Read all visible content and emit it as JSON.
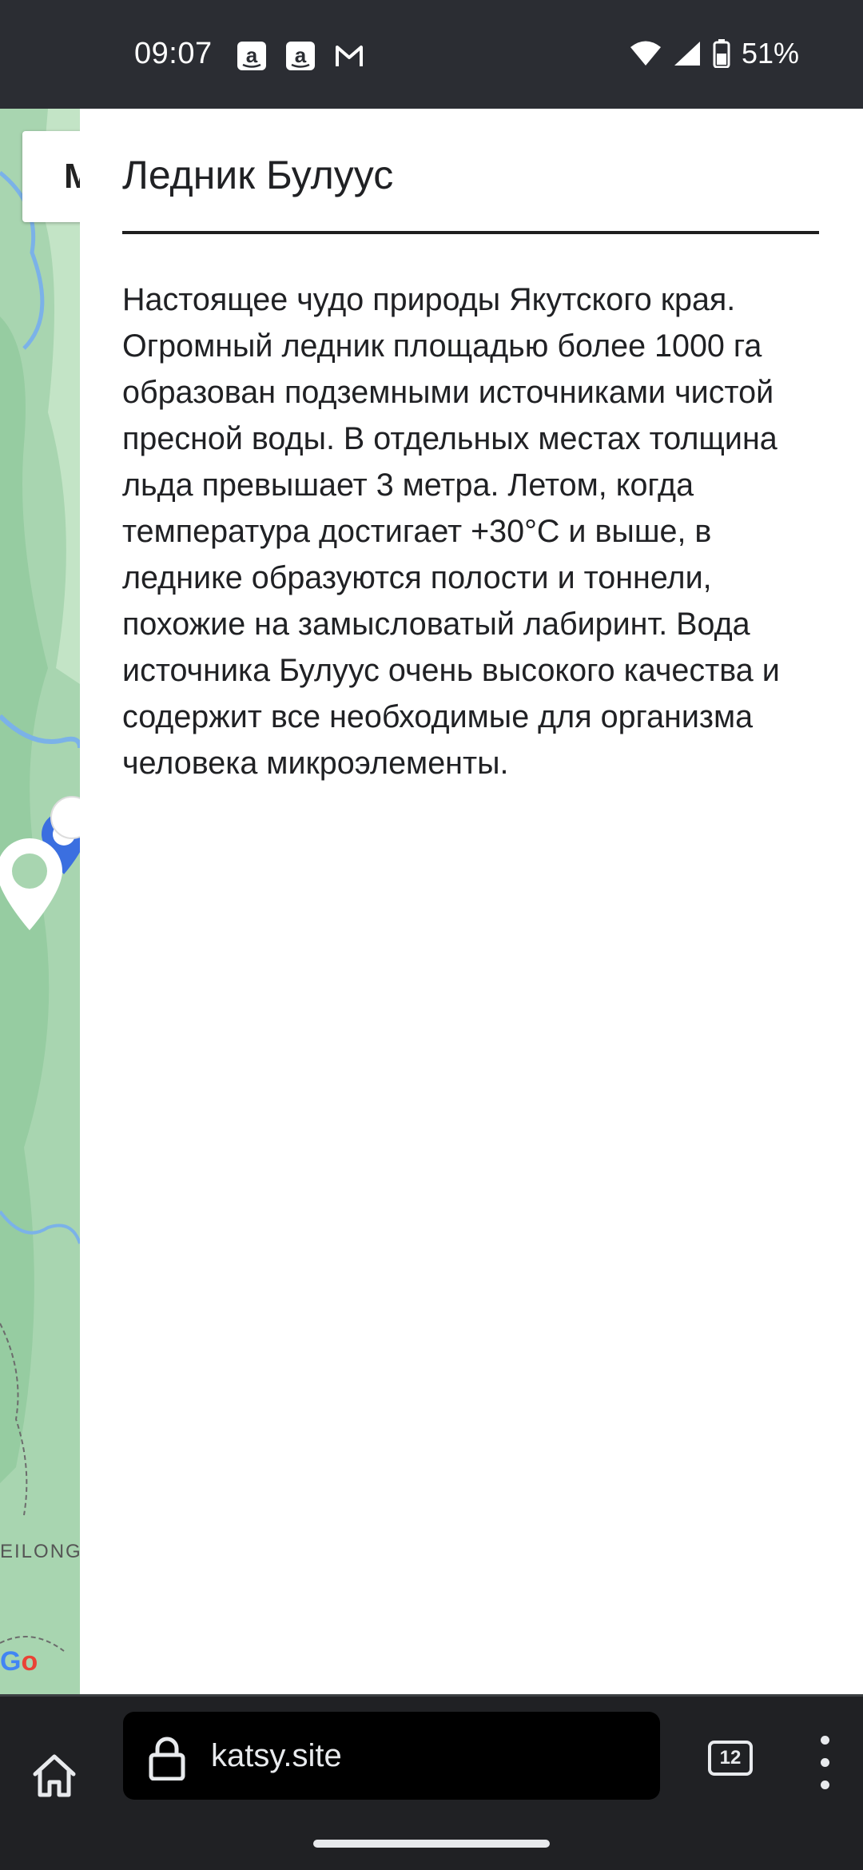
{
  "status_bar": {
    "time": "09:07",
    "battery": "51%",
    "icons": [
      "amazon-notification-icon",
      "amazon-notification-icon",
      "gmail-notification-icon",
      "wifi-icon",
      "cellular-signal-icon",
      "battery-icon"
    ]
  },
  "map": {
    "map_type_button_label": "M",
    "region_label": "EILONG",
    "google_logo_part1": "G",
    "google_logo_part2": "o"
  },
  "info_panel": {
    "title": "Ледник Булуус",
    "description": "Настоящее чудо природы Якутского края. Огромный ледник площадью более 1000 га образован подземными источниками чистой пресной воды. В отдельных местах толщина льда превышает 3 метра. Летом, когда температура достигает +30°С и выше, в леднике образуются полости и тоннели, похожие на замысловатый лабиринт. Вода источника Булуус очень высокого качества и содержит все необходимые для организма человека микроэлементы."
  },
  "browser": {
    "url": "katsy.site",
    "tab_count": "12"
  },
  "colors": {
    "status_bar_bg": "#2b2d33",
    "browser_bar_bg": "#202124",
    "panel_bg": "#ffffff",
    "map_green": "#a8d5b0",
    "marker_blue": "#3b6fe0"
  }
}
